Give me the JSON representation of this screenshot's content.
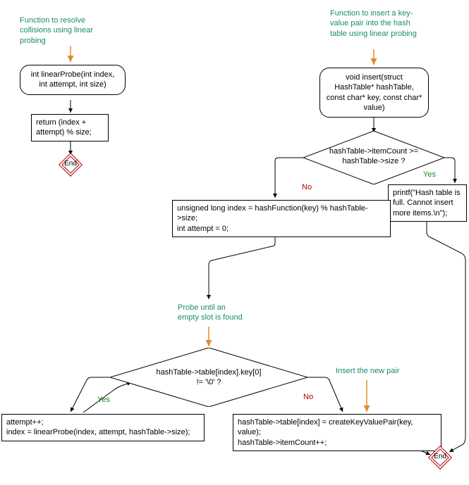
{
  "left": {
    "comment": "Function to resolve collisions using linear probing",
    "signature": "int linearProbe(int index, int attempt, int size)",
    "return": "return (index + attempt) % size;",
    "end": "End"
  },
  "right": {
    "comment": "Function to insert a key-value pair into the hash table using linear probing",
    "signature": "void insert(struct HashTable* hashTable, const char* key, const char* value)",
    "cond1": "hashTable->itemCount >= hashTable->size ?",
    "yes1": "printf(\"Hash table is full. Cannot insert more items.\\n\");",
    "no1": "unsigned long index = hashFunction(key) % hashTable->size;\nint attempt = 0;",
    "loopComment": "Probe until an empty slot is found",
    "cond2": "hashTable->table[index].key[0] != '\\0' ?",
    "loopYes": "attempt++;\nindex = linearProbe(index, attempt, hashTable->size);",
    "insertComment": "Insert the new pair",
    "loopNo": "hashTable->table[index] = createKeyValuePair(key, value);\nhashTable->itemCount++;",
    "end": "End",
    "labels": {
      "yes": "Yes",
      "no": "No"
    }
  }
}
